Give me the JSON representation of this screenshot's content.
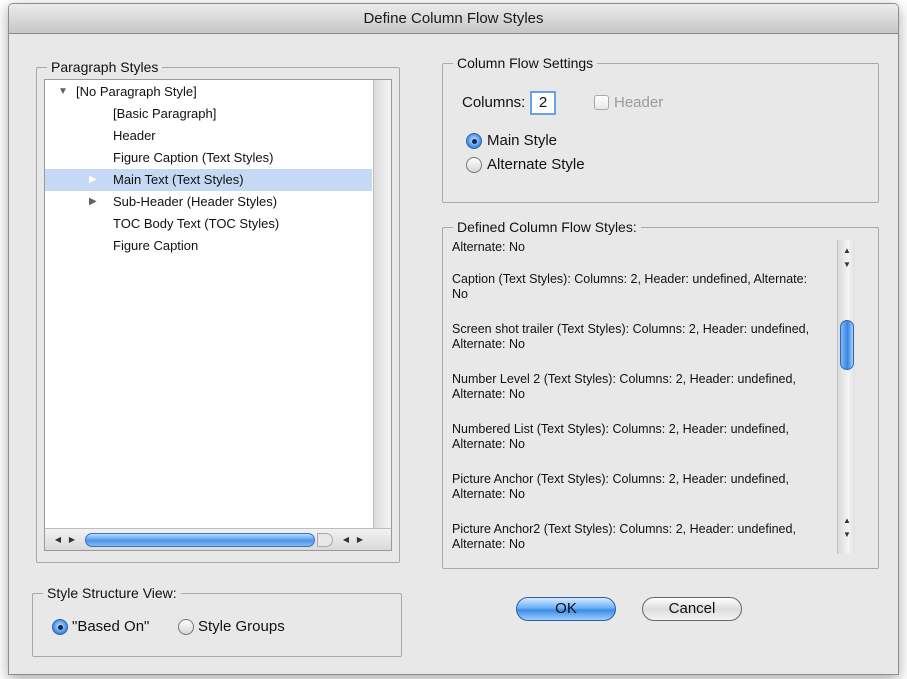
{
  "window": {
    "title": "Define Column Flow Styles"
  },
  "paragraph_styles": {
    "legend": "Paragraph Styles",
    "items": [
      {
        "label": "[No Paragraph Style]",
        "indent": 0,
        "expander": "expanded"
      },
      {
        "label": "[Basic Paragraph]",
        "indent": 1,
        "expander": "none"
      },
      {
        "label": "Header",
        "indent": 1,
        "expander": "none"
      },
      {
        "label": "Figure Caption (Text Styles)",
        "indent": 1,
        "expander": "none"
      },
      {
        "label": "Main Text (Text Styles)",
        "indent": 1,
        "expander": "collapsed",
        "selected": true
      },
      {
        "label": "Sub-Header (Header Styles)",
        "indent": 1,
        "expander": "collapsed"
      },
      {
        "label": "TOC Body Text (TOC Styles)",
        "indent": 1,
        "expander": "none"
      },
      {
        "label": "Figure Caption",
        "indent": 1,
        "expander": "none"
      }
    ]
  },
  "settings": {
    "legend": "Column Flow Settings",
    "columns_label": "Columns:",
    "columns_value": "2",
    "header_label": "Header",
    "header_checked": false,
    "header_disabled": true,
    "main_style_label": "Main Style",
    "alternate_style_label": "Alternate Style",
    "selected_style": "Main Style"
  },
  "defined": {
    "legend": "Defined Column Flow Styles:",
    "entries": [
      "Alternate: No",
      "Caption (Text Styles): Columns: 2, Header: undefined, Alternate: No",
      "Screen shot trailer (Text Styles): Columns: 2, Header: undefined, Alternate: No",
      "Number Level 2 (Text Styles): Columns: 2, Header: undefined, Alternate: No",
      "Numbered List (Text Styles): Columns: 2, Header: undefined, Alternate: No",
      "Picture Anchor (Text Styles): Columns: 2, Header: undefined, Alternate: No",
      "Picture Anchor2 (Text Styles): Columns: 2, Header: undefined, Alternate: No"
    ]
  },
  "structure_view": {
    "legend": "Style Structure View:",
    "based_on_label": "\"Based On\"",
    "style_groups_label": "Style Groups",
    "selected": "\"Based On\""
  },
  "buttons": {
    "ok": "OK",
    "cancel": "Cancel"
  },
  "colors": {
    "selection": "#c6d9f4",
    "accent": "#3f8ae5"
  }
}
